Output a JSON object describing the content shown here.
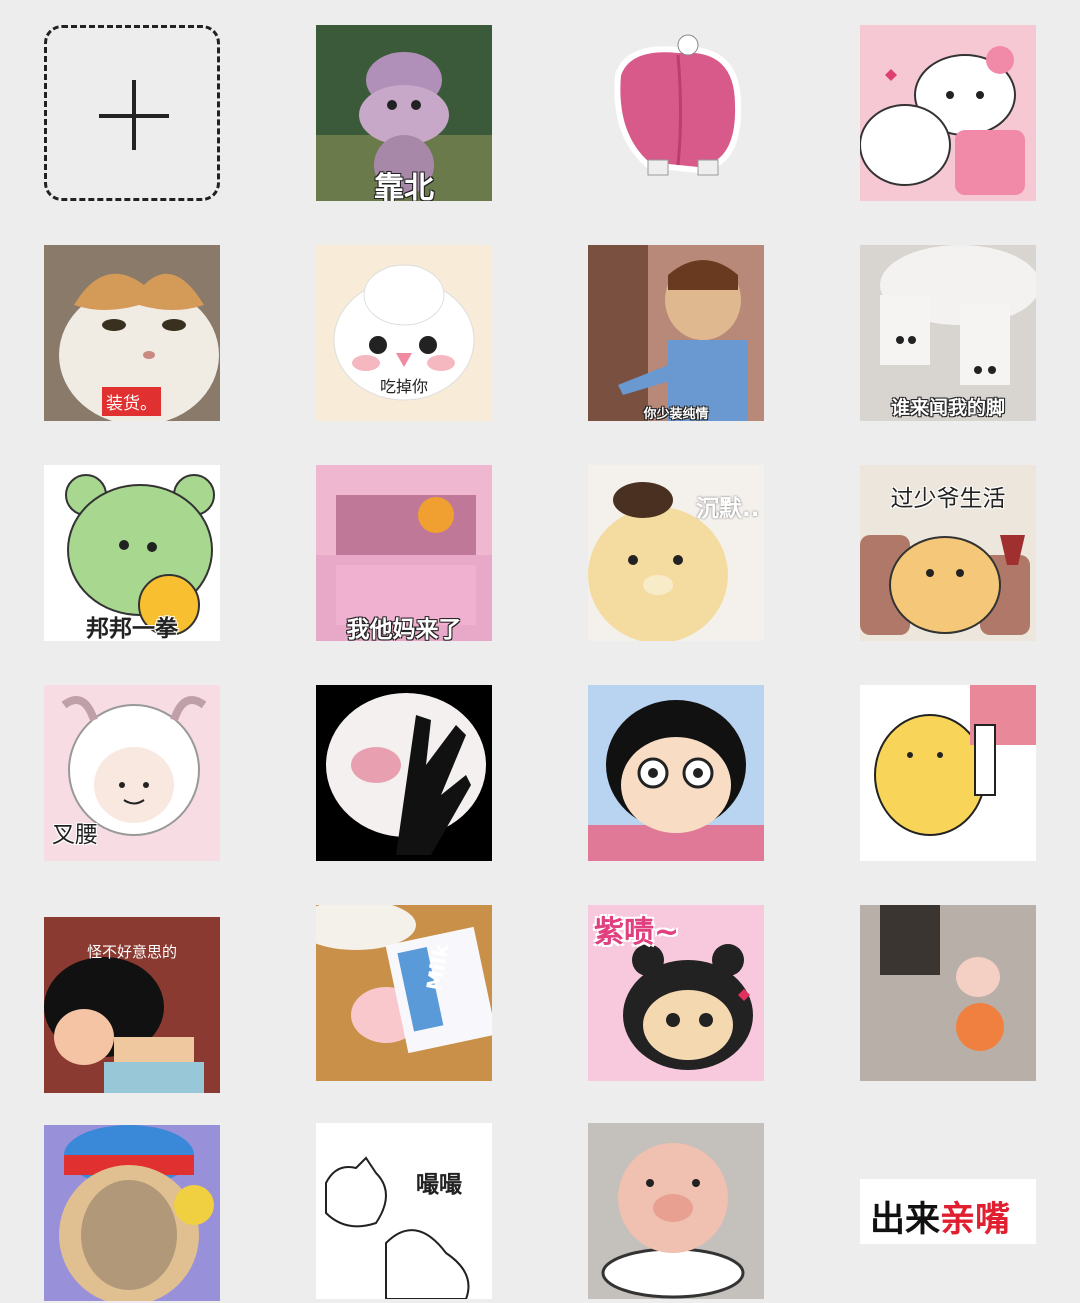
{
  "stickers": [
    {
      "caption": ""
    },
    {
      "caption": "靠北"
    },
    {
      "caption": ""
    },
    {
      "caption": ""
    },
    {
      "caption": "装货。"
    },
    {
      "caption": "吃掉你"
    },
    {
      "caption": "你少装纯情"
    },
    {
      "caption": "谁来闻我的脚"
    },
    {
      "caption": "邦邦一拳"
    },
    {
      "caption": "我他妈来了"
    },
    {
      "caption": "沉默.."
    },
    {
      "caption": "过少爷生活"
    },
    {
      "caption": "叉腰"
    },
    {
      "caption": ""
    },
    {
      "caption": ""
    },
    {
      "caption": ""
    },
    {
      "caption": "怪不好意思的"
    },
    {
      "caption": "Milk"
    },
    {
      "caption": "紫啧~"
    },
    {
      "caption": ""
    },
    {
      "caption": ""
    },
    {
      "caption": "嘬嘬"
    },
    {
      "caption": ""
    },
    {
      "caption_a": "出来",
      "caption_b": "亲嘴"
    }
  ]
}
